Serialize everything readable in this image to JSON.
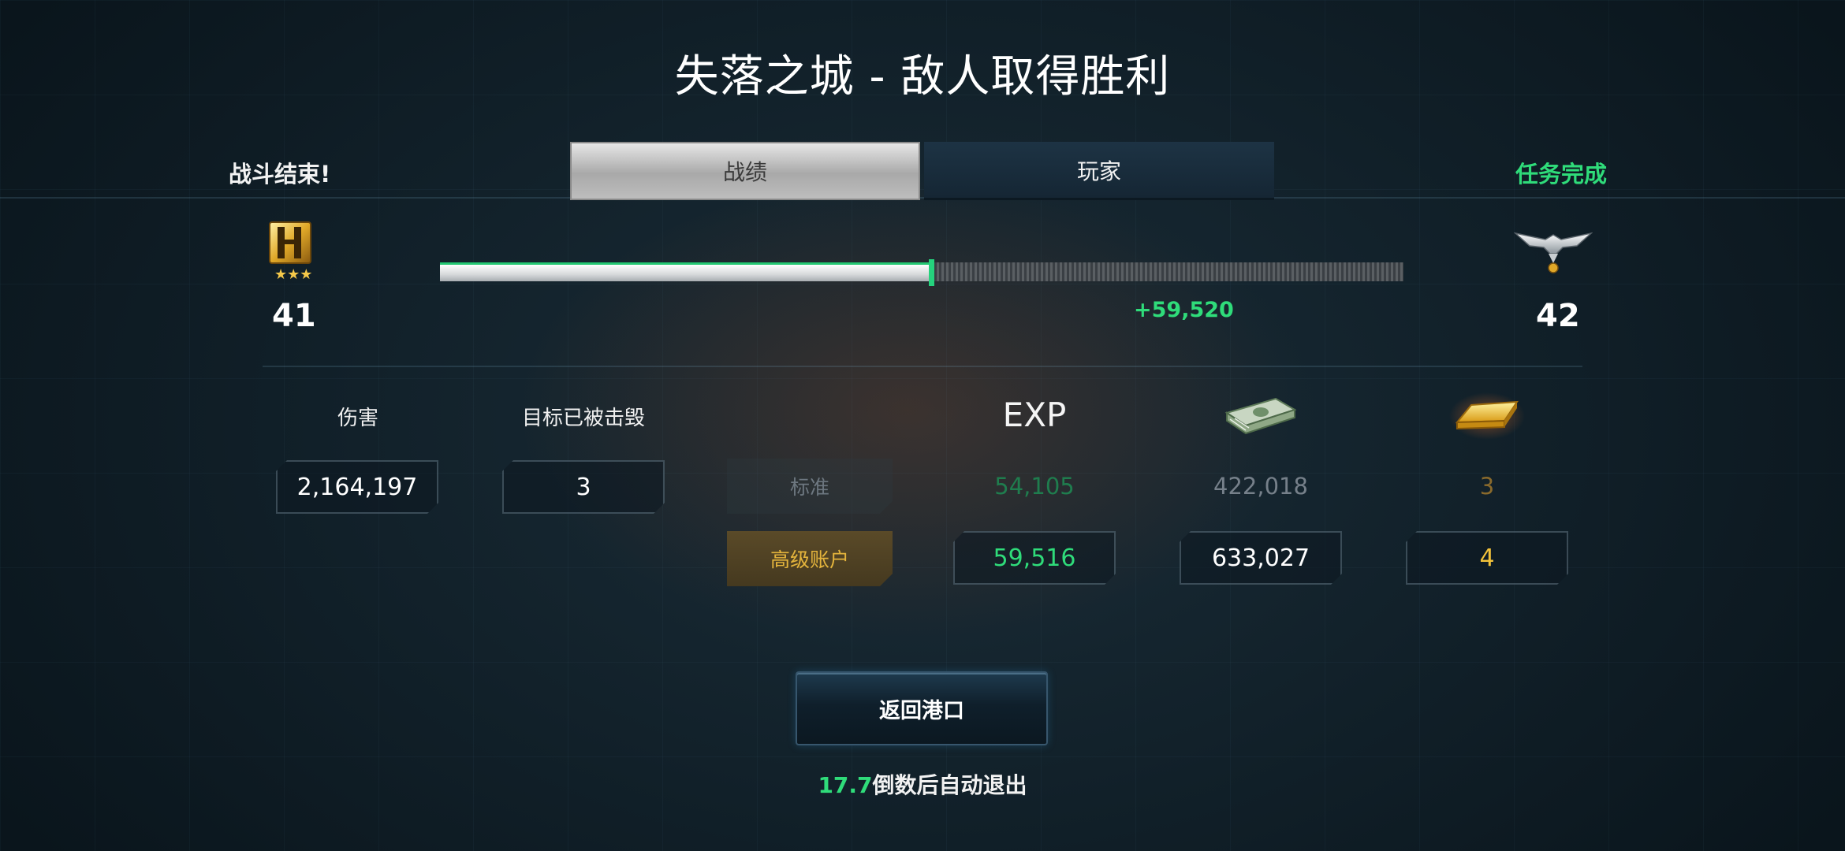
{
  "title": "失落之城 - 敌人取得胜利",
  "left_status": "战斗结束!",
  "right_status": "任务完成",
  "tabs": [
    {
      "label": "战绩",
      "active": true
    },
    {
      "label": "玩家",
      "active": false
    }
  ],
  "rank": {
    "current_level": "41",
    "next_level": "42",
    "current_icon": "gold-rank-insignia-icon",
    "next_icon": "silver-eagle-rank-icon"
  },
  "progress": {
    "fill_fraction": 0.51,
    "gain_label": "+59,520"
  },
  "stats": {
    "damage_label": "伤害",
    "damage_value": "2,164,197",
    "kills_label": "目标已被击毁",
    "kills_value": "3"
  },
  "rewards": {
    "exp_label": "EXP",
    "money_icon": "cash-stack-icon",
    "gold_icon": "gold-bar-icon",
    "standard": {
      "label": "标准",
      "exp": "54,105",
      "credits": "422,018",
      "gold": "3"
    },
    "premium": {
      "label": "高级账户",
      "exp": "59,516",
      "credits": "633,027",
      "gold": "4"
    }
  },
  "back_button": "返回港口",
  "countdown": {
    "seconds": "17.7",
    "text": "倒数后自动退出"
  },
  "colors": {
    "accent_green": "#2fdc7a",
    "gold": "#e4b43c"
  }
}
